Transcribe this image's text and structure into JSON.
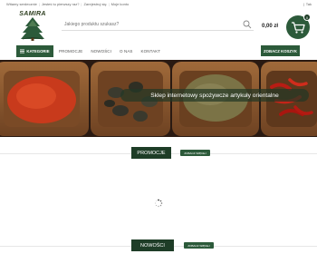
{
  "topbar": {
    "links": [
      "Witamy serdecznie",
      "Jesteś tu pierwszy raz?",
      "Zarejestruj się",
      "Moje konto"
    ],
    "separator": "|",
    "lang_separator": "|",
    "lang": "Tak"
  },
  "logo": {
    "brand": "SAMIRA"
  },
  "search": {
    "placeholder": "Jakiego produktu szukasz?"
  },
  "cart": {
    "total": "0,00 zł",
    "count": "0"
  },
  "nav": {
    "categories_label": "KATEGORIE",
    "items": [
      "PROMOCJE",
      "NOWOŚCI",
      "O NAS",
      "KONTAKT"
    ],
    "basket_label": "ZOBACZ KOSZYK"
  },
  "hero": {
    "caption": "Sklep internetowy spożywcze artykuły orientalne"
  },
  "sections": {
    "promo": {
      "title": "PROMOCJE",
      "more": "ZOBACZ WIĘCEJ"
    },
    "news": {
      "title": "NOWOŚCI",
      "more": "ZOBACZ WIĘCEJ"
    }
  },
  "colors": {
    "brand_green": "#2c5a3a",
    "dark_green": "#1e3d27",
    "wood": "#8b5a2b"
  },
  "icons": [
    "tree-logo",
    "search-icon",
    "cart-icon",
    "menu-icon",
    "loading-spinner"
  ]
}
